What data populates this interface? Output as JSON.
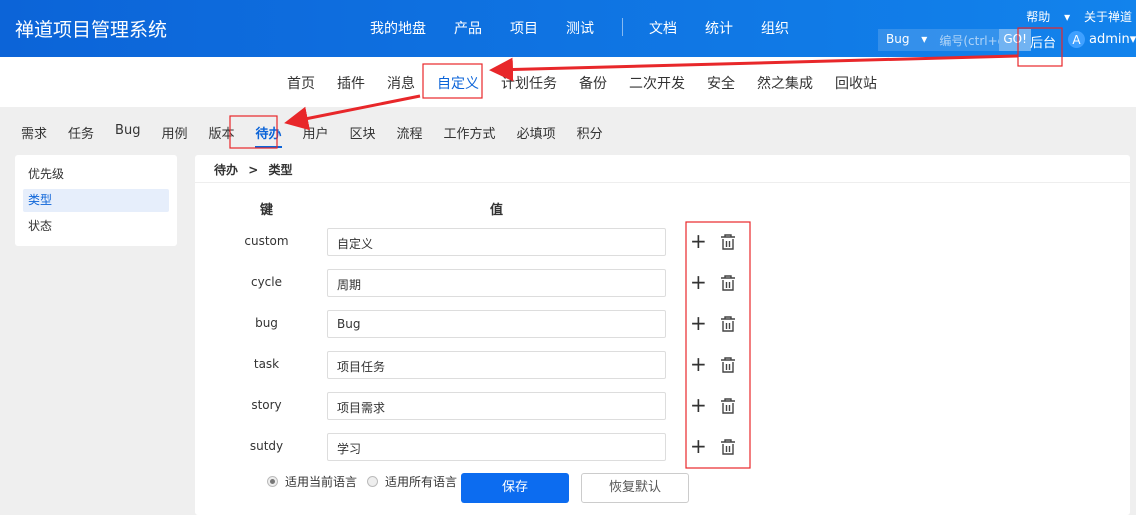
{
  "header": {
    "brand": "禅道项目管理系统",
    "nav": [
      "我的地盘",
      "产品",
      "项目",
      "测试",
      "文档",
      "统计",
      "组织"
    ],
    "help": "帮助",
    "about": "关于禅道",
    "search_type": "Bug",
    "search_placeholder": "编号(ctrl+g",
    "go": "GO!",
    "admin_link": "后台",
    "avatar_letter": "A",
    "user": "admin"
  },
  "subnav": {
    "items": [
      "首页",
      "插件",
      "消息",
      "自定义",
      "计划任务",
      "备份",
      "二次开发",
      "安全",
      "然之集成",
      "回收站"
    ],
    "active": "自定义"
  },
  "tabs": {
    "items": [
      "需求",
      "任务",
      "Bug",
      "用例",
      "版本",
      "待办",
      "用户",
      "区块",
      "流程",
      "工作方式",
      "必填项",
      "积分"
    ],
    "active": "待办"
  },
  "sidebar": {
    "items": [
      "优先级",
      "类型",
      "状态"
    ],
    "active": "类型"
  },
  "breadcrumb": {
    "parent": "待办",
    "sep": ">",
    "current": "类型"
  },
  "table": {
    "key_header": "键",
    "value_header": "值",
    "rows": [
      {
        "key": "custom",
        "value": "自定义"
      },
      {
        "key": "cycle",
        "value": "周期"
      },
      {
        "key": "bug",
        "value": "Bug"
      },
      {
        "key": "task",
        "value": "项目任务"
      },
      {
        "key": "story",
        "value": "项目需求"
      },
      {
        "key": "sutdy",
        "value": "学习"
      }
    ]
  },
  "footer": {
    "radio_current": "适用当前语言",
    "radio_all": "适用所有语言",
    "selected": "current",
    "save": "保存",
    "reset": "恢复默认"
  },
  "colors": {
    "brand": "#0c64d8",
    "annotation": "#e8272a"
  }
}
